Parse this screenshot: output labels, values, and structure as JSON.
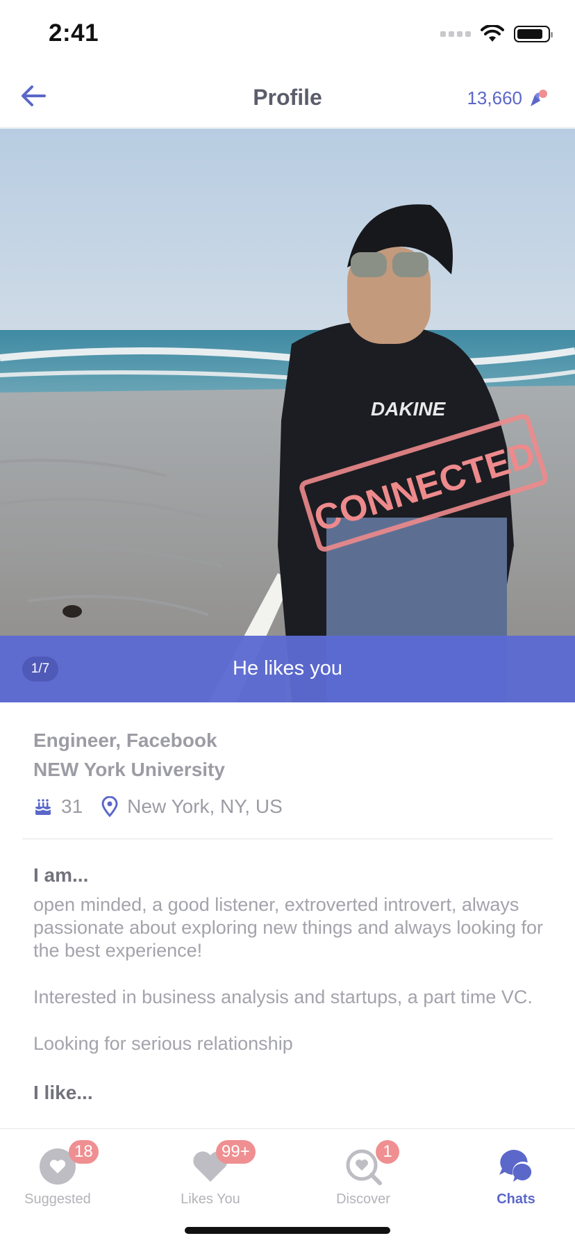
{
  "status_bar": {
    "time": "2:41"
  },
  "nav": {
    "title": "Profile",
    "coins": "13,660"
  },
  "photo": {
    "counter": "1/7",
    "likes_text": "He likes you",
    "stamp": "CONNECTED",
    "shirt_brand": "DAKINE"
  },
  "profile": {
    "occupation": "Engineer, Facebook",
    "school": "NEW York University",
    "age": "31",
    "location": "New York, NY, US"
  },
  "about": {
    "i_am_title": "I am...",
    "paragraphs": [
      "open minded, a good listener, extroverted introvert, always passionate about exploring new things and always looking for the best experience!",
      "Interested in business analysis and startups, a part time VC.",
      "Looking for serious relationship"
    ],
    "i_like_title": "I like..."
  },
  "tabs": [
    {
      "label": "Suggested",
      "badge": "18",
      "icon": "heart-circle-icon"
    },
    {
      "label": "Likes You",
      "badge": "99+",
      "icon": "heart-icon"
    },
    {
      "label": "Discover",
      "badge": "1",
      "icon": "heart-search-icon"
    },
    {
      "label": "Chats",
      "badge": "",
      "icon": "chat-bubbles-icon"
    }
  ],
  "colors": {
    "accent": "#5b67c9",
    "badge": "#ef8f91",
    "stamp": "#ee8a8c"
  }
}
